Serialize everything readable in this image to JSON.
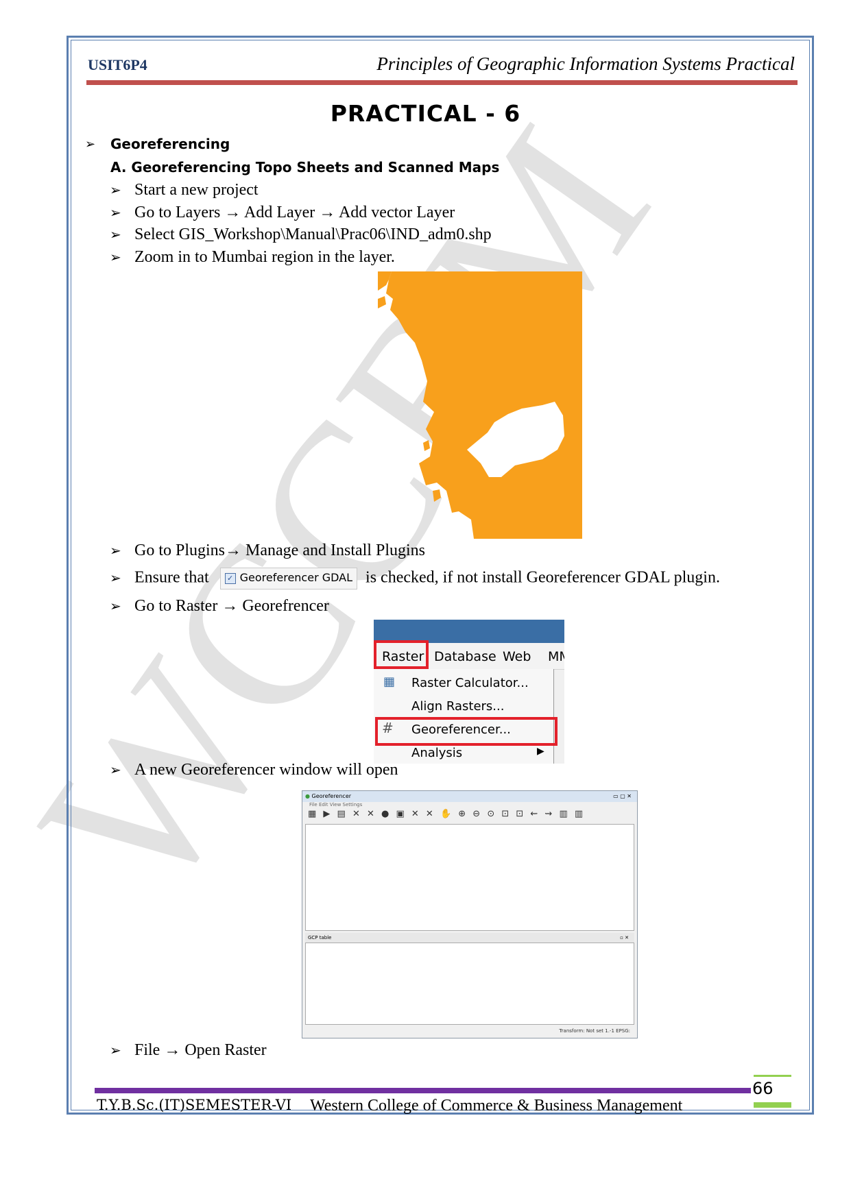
{
  "header": {
    "course_code": "USIT6P4",
    "course_title": "Principles of Geographic Information Systems Practical"
  },
  "practical_title": "PRACTICAL - 6",
  "section": {
    "title": "Georeferencing",
    "subsection": "A.  Georeferencing Topo Sheets and Scanned Maps"
  },
  "steps": [
    "Start a new project",
    "Go to Layers",
    "Add Layer",
    "Add vector Layer",
    "Select GIS_Workshop\\Manual\\Prac06\\IND_adm0.shp",
    "Zoom in to Mumbai region in the layer.",
    "Go to Plugins",
    "Manage and Install Plugins",
    "Ensure that",
    "is checked, if not install Georeferencer GDAL plugin.",
    "Go to Raster",
    "Georefrencer",
    "A new Georeferencer window will open",
    "File",
    "Open Raster"
  ],
  "plugin_chip": "Georeferencer GDAL",
  "menu": {
    "bar": [
      "Raster",
      "Database",
      "Web",
      "MM"
    ],
    "items": [
      "Raster Calculator...",
      "Align Rasters...",
      "Georeferencer...",
      "Analysis"
    ]
  },
  "geo_window": {
    "title": "Georeferencer",
    "menu": "File   Edit   View   Settings",
    "toolbar": "▦ ▶ ▤ ✕ ✕ ● ▣ ✕ ✕ ✋ ⊕ ⊖ ⊙ ⊡ ⊡ ⇜ ⇝ ▥ ▥",
    "gcp_label": "GCP table",
    "gcp_controls": "▫ ✕",
    "status": "Transform: Not set      1.-1      EPSG:",
    "win_buttons": "▭ ▢ ✕"
  },
  "arrow_glyph": "➢",
  "right_arrow": "→",
  "watermark": "WCCBM",
  "footer": {
    "left": "T.Y.B.Sc.(IT)SEMESTER-VI",
    "middle": "Western College of Commerce & Business Management",
    "page": "66"
  },
  "colors": {
    "border": "#5b7fb0",
    "header_rule": "#c0504d",
    "footer_rule": "#7030a0",
    "page_accent": "#92d050",
    "map_fill": "#f8a01c",
    "highlight": "#e3212b",
    "course_code": "#1f3864"
  }
}
